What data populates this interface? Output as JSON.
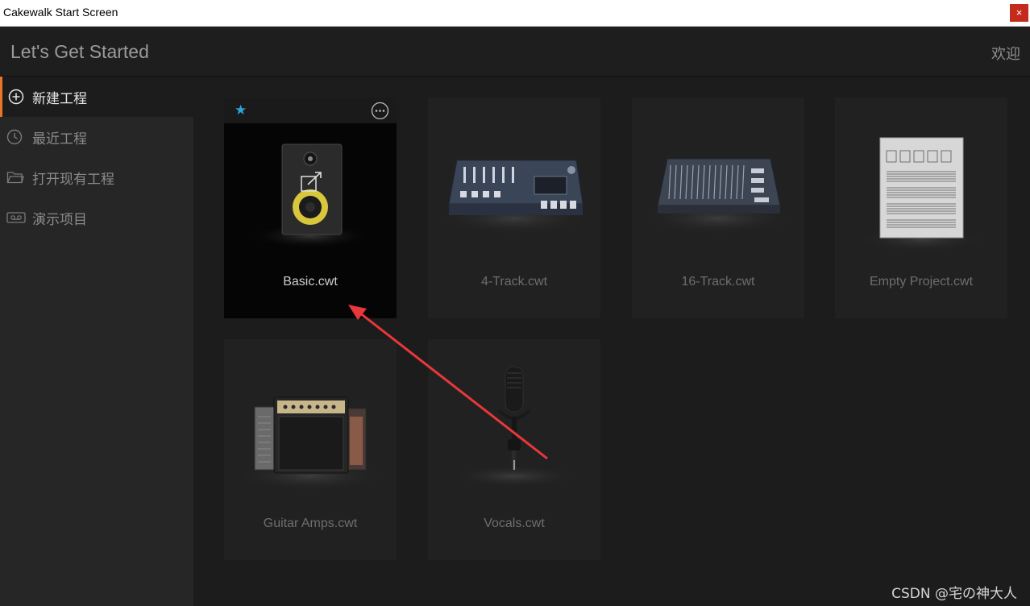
{
  "window": {
    "title": "Cakewalk Start Screen",
    "close_glyph": "×"
  },
  "header": {
    "title": "Let's Get Started",
    "welcome": "欢迎"
  },
  "sidebar": {
    "items": [
      {
        "label": "新建工程",
        "icon": "plus-circle-icon",
        "active": true
      },
      {
        "label": "最近工程",
        "icon": "clock-icon",
        "active": false
      },
      {
        "label": "打开现有工程",
        "icon": "folder-icon",
        "active": false
      },
      {
        "label": "演示项目",
        "icon": "cassette-icon",
        "active": false
      }
    ]
  },
  "templates": [
    {
      "label": "Basic.cwt",
      "icon": "speaker-icon",
      "selected": true
    },
    {
      "label": "4-Track.cwt",
      "icon": "tape-mixer-icon",
      "selected": false
    },
    {
      "label": "16-Track.cwt",
      "icon": "mixing-console-icon",
      "selected": false
    },
    {
      "label": "Empty Project.cwt",
      "icon": "sheet-music-icon",
      "selected": false
    },
    {
      "label": "Guitar Amps.cwt",
      "icon": "guitar-amp-icon",
      "selected": false
    },
    {
      "label": "Vocals.cwt",
      "icon": "microphone-icon",
      "selected": false
    }
  ],
  "card_controls": {
    "favorite_glyph": "★",
    "more_glyph": "···"
  },
  "watermark": "CSDN @宅の神大人",
  "colors": {
    "accent": "#e8752a",
    "favorite": "#2aa6d9",
    "annotation_arrow": "#e8373a",
    "close_button": "#c42b1c"
  }
}
